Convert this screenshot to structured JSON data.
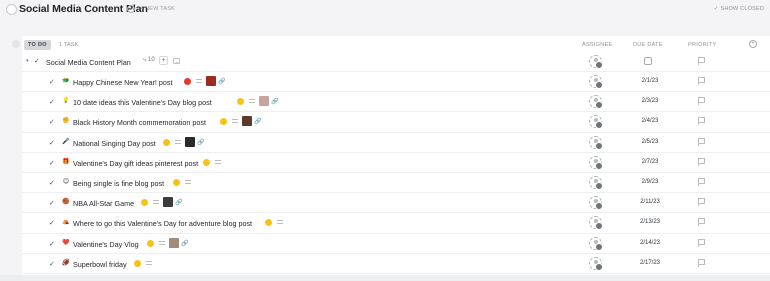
{
  "header": {
    "title": "Social Media Content Plan",
    "new_task": "+ NEW TASK",
    "show_closed": "SHOW CLOSED",
    "show_closed_check": "✓"
  },
  "group": {
    "status": "TO DO",
    "task_count": "1 TASK",
    "columns": {
      "assignee": "ASSIGNEE",
      "due_date": "DUE DATE",
      "priority": "PRIORITY"
    },
    "add_column": "+"
  },
  "parent_task": {
    "name": "Social Media Content Plan",
    "subtask_count": "⤷ 10",
    "plus": "+"
  },
  "tasks": [
    {
      "name": "Happy Chinese New Year! post",
      "due": "2/1/23",
      "emoji": "🐲",
      "dot_color": "#e5382c",
      "thumb_color": "#9b2a1f"
    },
    {
      "name": "10 date ideas this Valentine's Day blog post",
      "due": "2/3/23",
      "emoji": "💡",
      "dot_color": "#f5c21b",
      "thumb_color": "#c9a39d"
    },
    {
      "name": "Black History Month commemoration post",
      "due": "2/4/23",
      "emoji": "✊",
      "dot_color": "#f5c21b",
      "thumb_color": "#5a3a2a"
    },
    {
      "name": "National Singing Day post",
      "due": "2/5/23",
      "emoji": "🎤",
      "dot_color": "#f5c21b",
      "thumb_color": "#2a2a2a"
    },
    {
      "name": "Valentine's Day gift ideas pinterest post",
      "due": "2/7/23",
      "emoji": "🎁",
      "dot_color": "#f5c21b",
      "thumb_color": ""
    },
    {
      "name": "Being single is fine blog post",
      "due": "2/9/23",
      "emoji": "😊",
      "dot_color": "#f5c21b",
      "thumb_color": ""
    },
    {
      "name": "NBA All-Star Game",
      "due": "2/11/23",
      "emoji": "🏀",
      "dot_color": "#f5c21b",
      "thumb_color": "#3c3c3c"
    },
    {
      "name": "Where to go this Valentine's Day for adventure blog post",
      "due": "2/13/23",
      "emoji": "⛺",
      "dot_color": "#f5c21b",
      "thumb_color": ""
    },
    {
      "name": "Valentine's Day Vlog",
      "due": "2/14/23",
      "emoji": "❤️",
      "dot_color": "#f5c21b",
      "thumb_color": "#a08a7a"
    },
    {
      "name": "Superbowl friday",
      "due": "2/17/23",
      "emoji": "🏈",
      "dot_color": "#f5c21b",
      "thumb_color": ""
    }
  ]
}
